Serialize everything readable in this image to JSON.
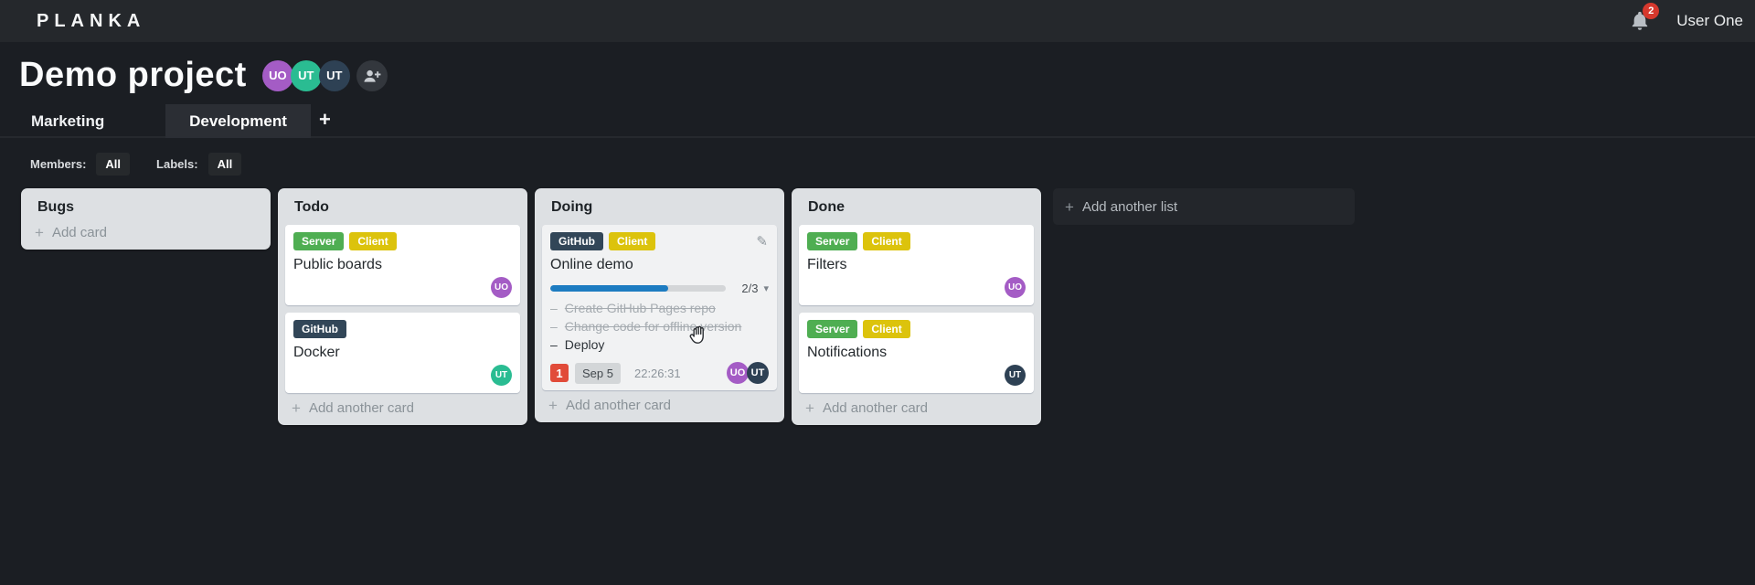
{
  "icons": {
    "plus": "+",
    "pencil": "✎",
    "caret_down": "▾",
    "dash": "–"
  },
  "topbar": {
    "logo": "PLANKA",
    "notifications_count": "2",
    "user_name": "User One"
  },
  "project": {
    "title": "Demo project",
    "members": [
      {
        "initials": "UO",
        "color": "#a45cc5"
      },
      {
        "initials": "UT",
        "color": "#2abc92"
      },
      {
        "initials": "UT",
        "color": "#2e4154"
      }
    ]
  },
  "tabs": {
    "items": [
      {
        "label": "Marketing",
        "active": false
      },
      {
        "label": "Development",
        "active": true
      }
    ],
    "add_button": "+"
  },
  "filters": {
    "members_label": "Members:",
    "members_value": "All",
    "labels_label": "Labels:",
    "labels_value": "All"
  },
  "board": {
    "add_list_label": "Add another list",
    "lists": [
      {
        "title": "Bugs",
        "add_card_label": "Add card",
        "cards": []
      },
      {
        "title": "Todo",
        "add_card_label": "Add another card",
        "cards": [
          {
            "title": "Public boards",
            "labels": [
              {
                "text": "Server",
                "color": "#4fae52"
              },
              {
                "text": "Client",
                "color": "#dcc30c"
              }
            ],
            "members": [
              {
                "initials": "UO",
                "color": "#a45cc5"
              }
            ]
          },
          {
            "title": "Docker",
            "labels": [
              {
                "text": "GitHub",
                "color": "#324658"
              }
            ],
            "members": [
              {
                "initials": "UT",
                "color": "#2abc92"
              }
            ]
          }
        ]
      },
      {
        "title": "Doing",
        "add_card_label": "Add another card",
        "cards": [
          {
            "title": "Online demo",
            "labels": [
              {
                "text": "GitHub",
                "color": "#324658"
              },
              {
                "text": "Client",
                "color": "#dcc30c"
              }
            ],
            "tasks_progress": {
              "completed": 2,
              "total": 3,
              "display": "2/3",
              "bar_color": "#1d7cc1"
            },
            "tasks": [
              {
                "text": "Create GitHub Pages repo",
                "done": true
              },
              {
                "text": "Change code for offline version",
                "done": true
              },
              {
                "text": "Deploy",
                "done": false
              }
            ],
            "notifications_count": "1",
            "due_date": "Sep 5",
            "timer": "22:26:31",
            "members": [
              {
                "initials": "UO",
                "color": "#a45cc5"
              },
              {
                "initials": "UT",
                "color": "#2e4154"
              }
            ]
          }
        ]
      },
      {
        "title": "Done",
        "add_card_label": "Add another card",
        "cards": [
          {
            "title": "Filters",
            "labels": [
              {
                "text": "Server",
                "color": "#4fae52"
              },
              {
                "text": "Client",
                "color": "#dcc30c"
              }
            ],
            "members": [
              {
                "initials": "UO",
                "color": "#a45cc5"
              }
            ]
          },
          {
            "title": "Notifications",
            "labels": [
              {
                "text": "Server",
                "color": "#4fae52"
              },
              {
                "text": "Client",
                "color": "#dcc30c"
              }
            ],
            "members": [
              {
                "initials": "UT",
                "color": "#2e4154"
              }
            ]
          }
        ]
      }
    ]
  }
}
